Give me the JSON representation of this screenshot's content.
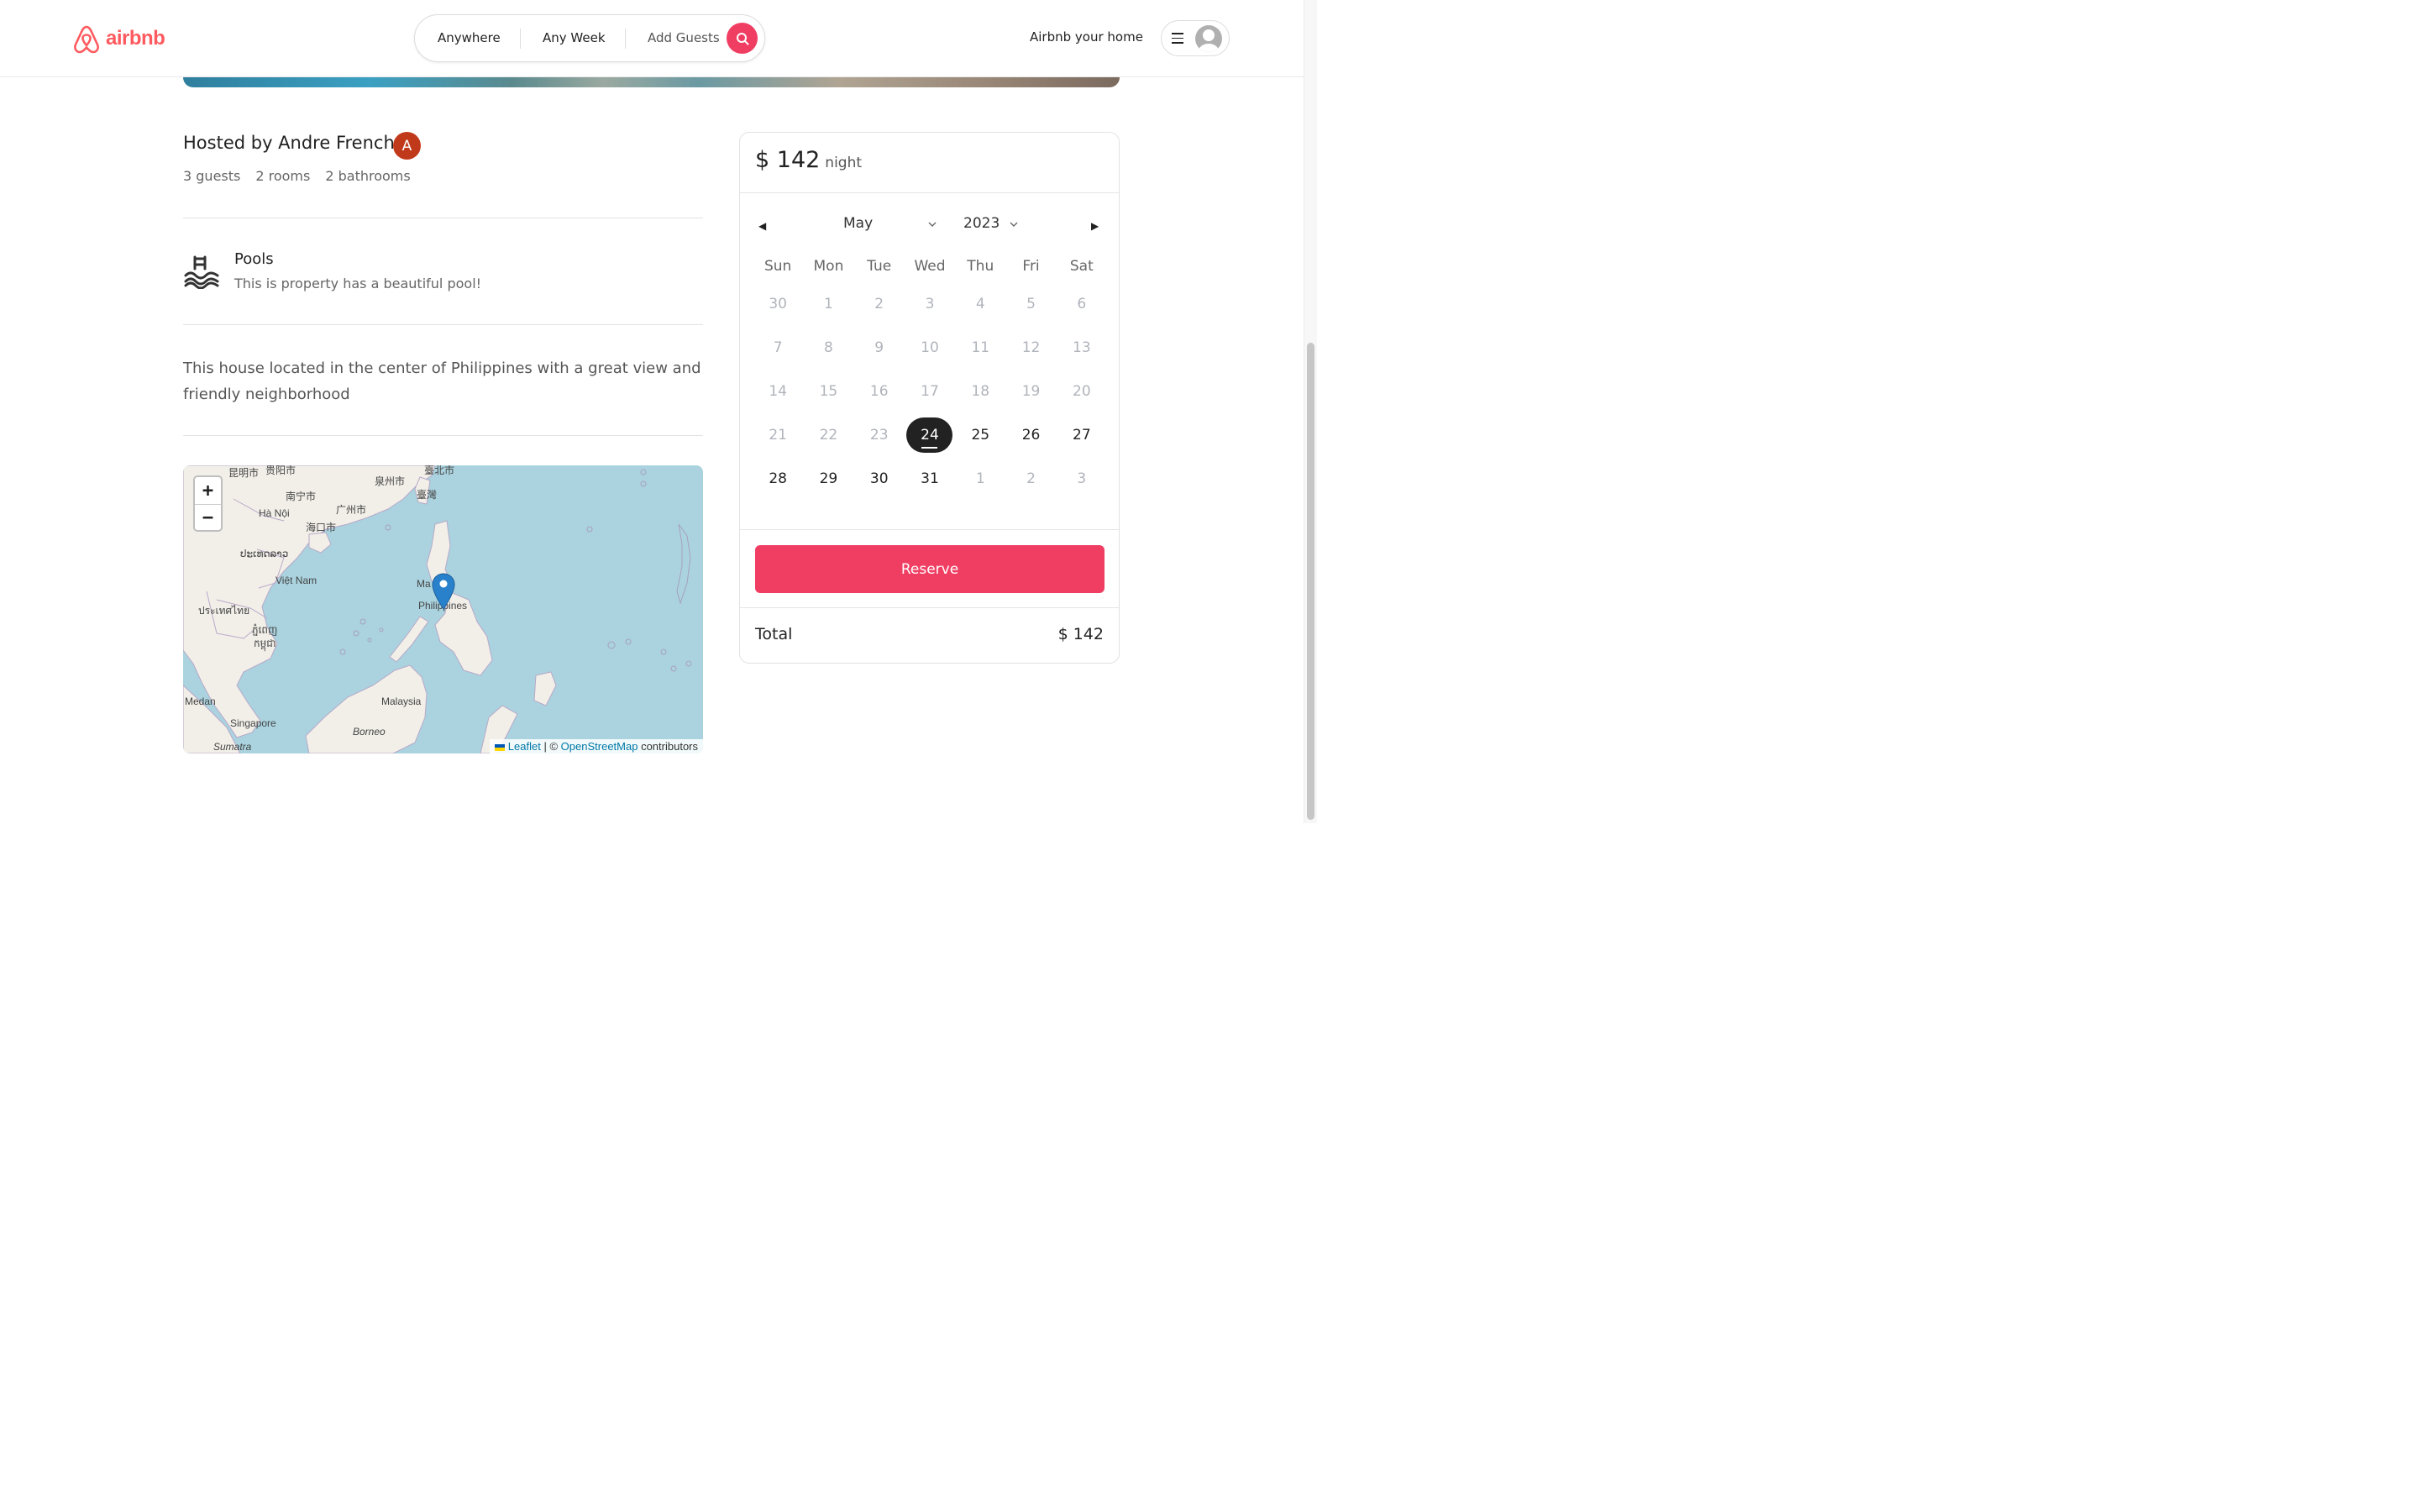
{
  "header": {
    "logo_text": "airbnb",
    "search": {
      "where": "Anywhere",
      "when": "Any Week",
      "guests": "Add Guests"
    },
    "host_link": "Airbnb your home"
  },
  "listing": {
    "host_title": "Hosted by Andre French",
    "host_initial": "A",
    "stats": [
      "3 guests",
      "2 rooms",
      "2 bathrooms"
    ],
    "feature": {
      "title": "Pools",
      "description": "This is property has a beautiful pool!"
    },
    "description": "This house located in the center of Philippines with a great view and friendly neighborhood"
  },
  "map": {
    "zoom_in": "+",
    "zoom_out": "−",
    "labels": [
      "昆明市",
      "贵阳市",
      "南宁市",
      "泉州市",
      "臺北市",
      "臺灣",
      "广州市",
      "Hà Nội",
      "海口市",
      "ປະເທດລາວ",
      "Việt Nam",
      "Ma",
      "Philippines",
      "ประเทศไทย",
      "ភ្នំពេញ",
      "កម្ពុជា",
      "Malaysia",
      "Medan",
      "Singapore",
      "Borneo",
      "Sumatra"
    ],
    "attribution": {
      "leaflet": "Leaflet",
      "sep": "| ©",
      "osm": "OpenStreetMap",
      "contrib": "contributors"
    }
  },
  "booking": {
    "price": "$ 142",
    "unit": "night",
    "month": "May",
    "year": "2023",
    "weekdays": [
      "Sun",
      "Mon",
      "Tue",
      "Wed",
      "Thu",
      "Fri",
      "Sat"
    ],
    "weeks": [
      [
        {
          "d": "30",
          "m": true
        },
        {
          "d": "1",
          "m": true
        },
        {
          "d": "2",
          "m": true
        },
        {
          "d": "3",
          "m": true
        },
        {
          "d": "4",
          "m": true
        },
        {
          "d": "5",
          "m": true
        },
        {
          "d": "6",
          "m": true
        }
      ],
      [
        {
          "d": "7",
          "m": true
        },
        {
          "d": "8",
          "m": true
        },
        {
          "d": "9",
          "m": true
        },
        {
          "d": "10",
          "m": true
        },
        {
          "d": "11",
          "m": true
        },
        {
          "d": "12",
          "m": true
        },
        {
          "d": "13",
          "m": true
        }
      ],
      [
        {
          "d": "14",
          "m": true
        },
        {
          "d": "15",
          "m": true
        },
        {
          "d": "16",
          "m": true
        },
        {
          "d": "17",
          "m": true
        },
        {
          "d": "18",
          "m": true
        },
        {
          "d": "19",
          "m": true
        },
        {
          "d": "20",
          "m": true
        }
      ],
      [
        {
          "d": "21",
          "m": true
        },
        {
          "d": "22",
          "m": true
        },
        {
          "d": "23",
          "m": true
        },
        {
          "d": "24",
          "s": true
        },
        {
          "d": "25"
        },
        {
          "d": "26"
        },
        {
          "d": "27"
        }
      ],
      [
        {
          "d": "28"
        },
        {
          "d": "29"
        },
        {
          "d": "30"
        },
        {
          "d": "31"
        },
        {
          "d": "1",
          "m": true
        },
        {
          "d": "2",
          "m": true
        },
        {
          "d": "3",
          "m": true
        }
      ]
    ],
    "reserve_label": "Reserve",
    "total_label": "Total",
    "total_value": "$ 142"
  },
  "colors": {
    "brand": "#ff5a5f",
    "accent": "#f03e63",
    "map_water": "#aad3df"
  }
}
